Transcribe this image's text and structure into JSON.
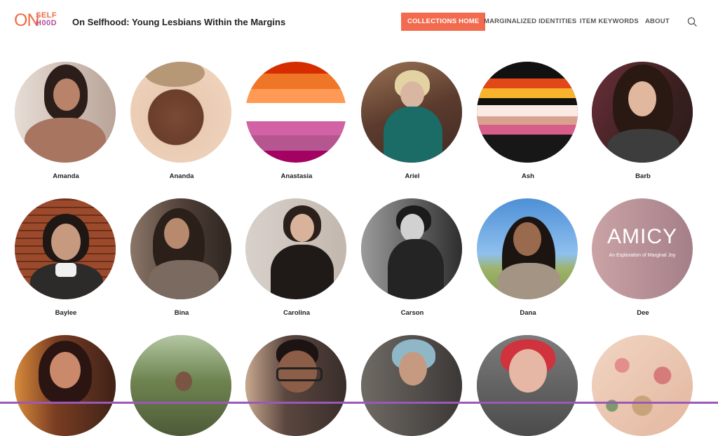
{
  "brand": {
    "logo_on": "ON",
    "logo_self": "SELF",
    "logo_hood": "H00D",
    "title": "On Selfhood: Young Lesbians Within the Margins",
    "accent": "#f26b4f",
    "logo_orange": "#ef6c43",
    "logo_purple": "#b64e9b"
  },
  "nav": {
    "items": [
      {
        "label": "COLLECTIONS HOME",
        "active": true
      },
      {
        "label": "MARGINALIZED IDENTITIES",
        "active": false
      },
      {
        "label": "ITEM KEYWORDS",
        "active": false
      },
      {
        "label": "ABOUT",
        "active": false
      }
    ],
    "search_icon": "search-icon"
  },
  "people": [
    {
      "name": "Amanda"
    },
    {
      "name": "Ananda"
    },
    {
      "name": "Anastasia"
    },
    {
      "name": "Ariel"
    },
    {
      "name": "Ash"
    },
    {
      "name": "Barb"
    },
    {
      "name": "Baylee"
    },
    {
      "name": "Bina"
    },
    {
      "name": "Carolina"
    },
    {
      "name": "Carson"
    },
    {
      "name": "Dana"
    },
    {
      "name": "Dee"
    },
    {
      "name": ""
    },
    {
      "name": ""
    },
    {
      "name": ""
    },
    {
      "name": ""
    },
    {
      "name": ""
    },
    {
      "name": ""
    }
  ],
  "amicy": {
    "title": "AMICY",
    "subtitle": "An Exploration of Marginal Joy"
  }
}
